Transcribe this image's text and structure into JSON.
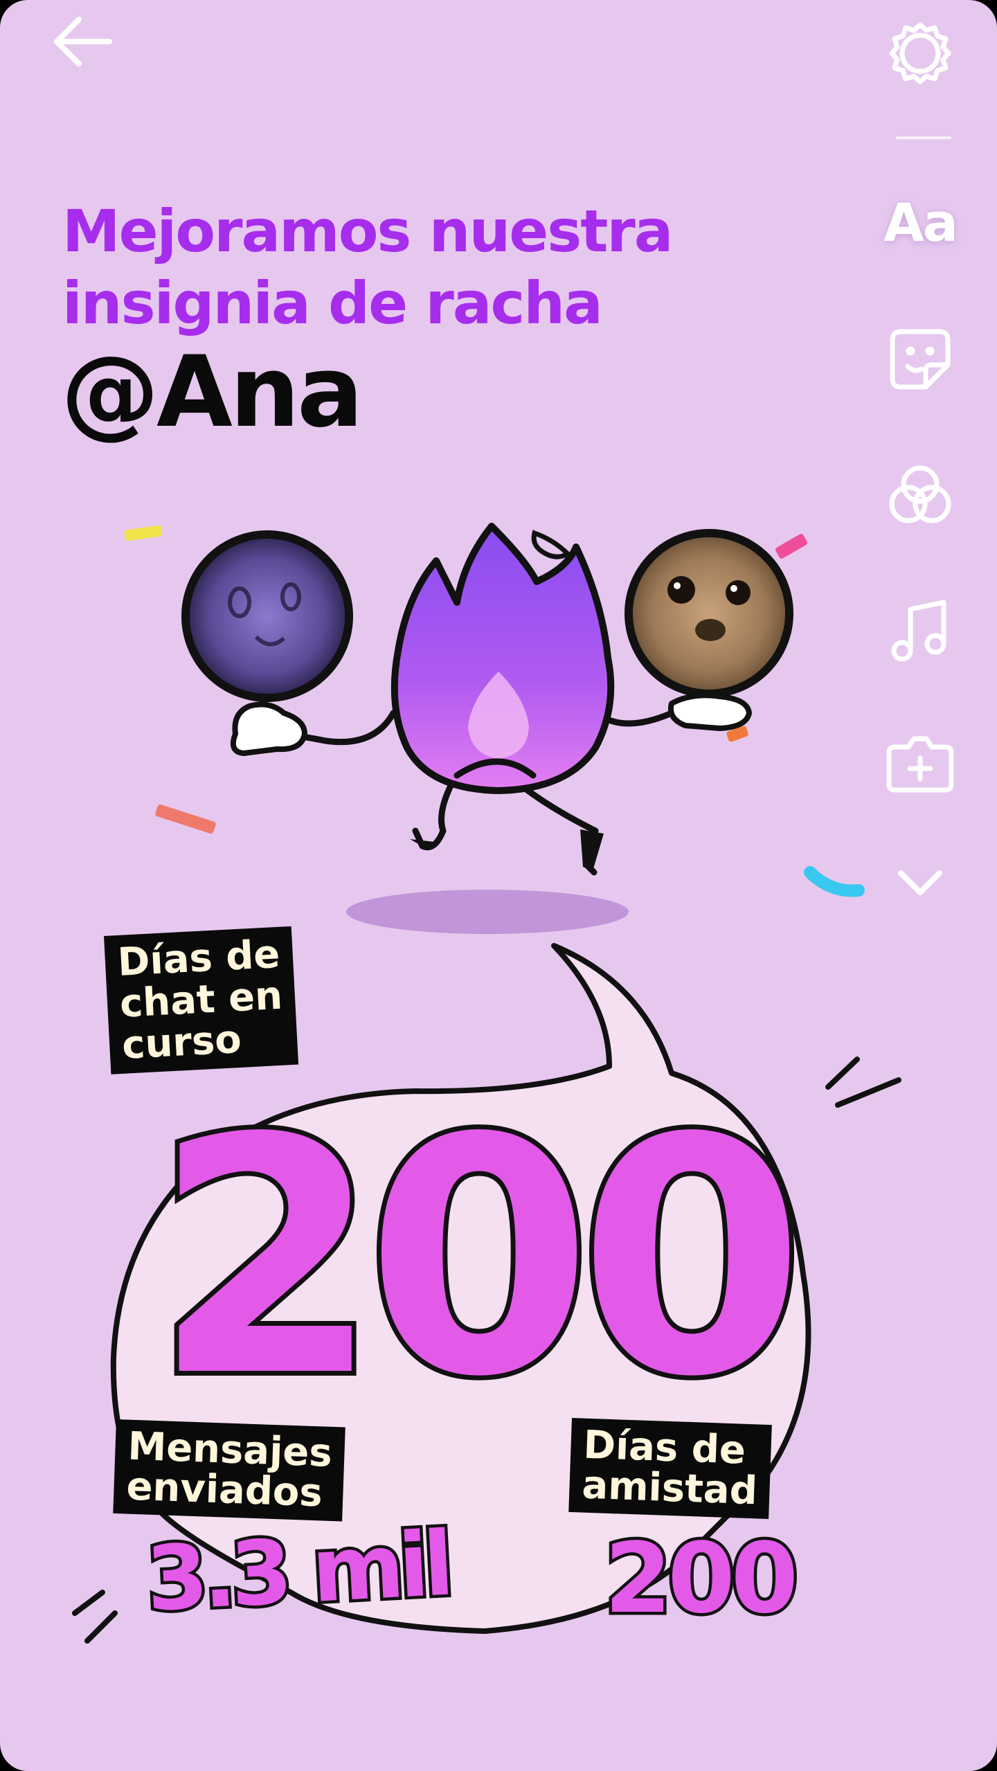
{
  "nav": {
    "back_icon": "arrow-left-icon",
    "settings_icon": "gear-icon"
  },
  "tools": {
    "text_label": "Aa",
    "items": [
      {
        "name": "text-tool",
        "icon": "text-aa-icon"
      },
      {
        "name": "sticker-tool",
        "icon": "sticker-icon"
      },
      {
        "name": "filters-tool",
        "icon": "circles-filter-icon"
      },
      {
        "name": "music-tool",
        "icon": "music-note-icon"
      },
      {
        "name": "add-media-tool",
        "icon": "camera-plus-icon"
      },
      {
        "name": "more-tools",
        "icon": "chevron-down-icon"
      }
    ]
  },
  "headline": {
    "line1": "Mejoramos nuestra",
    "line2": "insignia de racha"
  },
  "username": "@Ana",
  "stats": {
    "chat_days": {
      "label": "Días de\nchat en\ncurso",
      "value": "200"
    },
    "messages": {
      "label": "Mensajes\nenviados",
      "value": "3.3 mil"
    },
    "friendship": {
      "label": "Días de\namistad",
      "value": "200"
    }
  },
  "colors": {
    "background": "#e6c8ef",
    "headline": "#a72ded",
    "number_fill": "#e35ae8",
    "bubble": "#f4e0f0"
  }
}
